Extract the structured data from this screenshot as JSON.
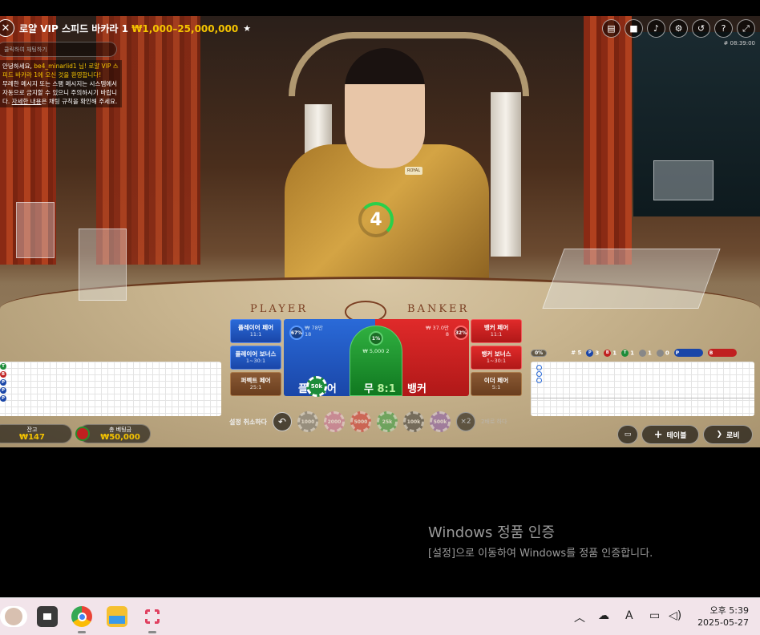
{
  "game": {
    "title": "로얄 VIP 스피드 바카라 1",
    "limit": "₩1,000–25,000,000",
    "round_id": "# 08:39:00",
    "timer": "4",
    "table_left_word": "PLAYER",
    "table_right_word": "BANKER",
    "dealer_badge": "ROYAL"
  },
  "chat": {
    "placeholder": "클릭하여 채팅하기",
    "line1_prefix": "안녕하세요, ",
    "line1_user": "be4_minarlid1",
    "line1_rest": " 님! 로얄 VIP 스피드 바카라 1에 오신 것을 환영합니다!",
    "line2": "무례한 메시지 또는 스팸 메시지는 시스템에서 자동으로 금지할 수 있으니 주의하시기 바랍니다. ",
    "line2_link_a": "자세한 내용",
    "line2_end": "은 채팅 규칙을 확인해 주세요."
  },
  "bets": {
    "player_pair": {
      "label": "플레이어 페어",
      "odds": "11:1"
    },
    "player_bonus": {
      "label": "플레이어 보너스",
      "odds": "1~30:1"
    },
    "perfect_pair": {
      "label": "퍼펙트 페어",
      "odds": "25:1"
    },
    "banker_pair": {
      "label": "뱅커 페어",
      "odds": "11:1"
    },
    "banker_bonus": {
      "label": "뱅커 보너스",
      "odds": "1~30:1"
    },
    "either_pair": {
      "label": "이더 페어",
      "odds": "5:1"
    },
    "player": {
      "label": "플레이어",
      "pct": "67%",
      "amount": "₩ 78만",
      "count": "18"
    },
    "tie": {
      "label": "무",
      "odds": "8:1",
      "pct": "1%",
      "amount": "₩ 5,000",
      "count": "2"
    },
    "banker": {
      "label": "뱅커",
      "pct": "32%",
      "amount": "₩ 37.0만",
      "count": "8"
    },
    "placed_chip": "50k"
  },
  "chips": {
    "undo_label": "설정 취소하다",
    "values": [
      "1000",
      "2000",
      "5000",
      "25k",
      "100k",
      "500k"
    ],
    "colors": [
      "#7a7a7a",
      "#d070a0",
      "#d83030",
      "#30a040",
      "#3a3a3a",
      "#8a5ab0"
    ],
    "double": "×2",
    "repeat": "2배로 하다"
  },
  "stats": {
    "round": "# 5",
    "player": "3",
    "banker": "1",
    "tie": "1",
    "player_pair": "1",
    "banker_pair": "0",
    "road_pct": "0%"
  },
  "balance": {
    "label": "잔고",
    "value": "₩147",
    "total_label": "총 베팅금",
    "total_value": "₩50,000"
  },
  "buttons": {
    "table": "테이블",
    "lobby": "로비"
  },
  "road_left": [
    "T",
    "B",
    "P",
    "P",
    "P"
  ],
  "windows": {
    "activate_title": "Windows 정품 인증",
    "activate_sub": "[설정]으로 이동하여 Windows를 정품 인증합니다."
  },
  "taskbar": {
    "time": "오후 5:39",
    "date": "2025-05-27"
  },
  "colors": {
    "player": "#1a46a8",
    "banker": "#b01818",
    "tie": "#107820",
    "gold": "#f5c400"
  }
}
